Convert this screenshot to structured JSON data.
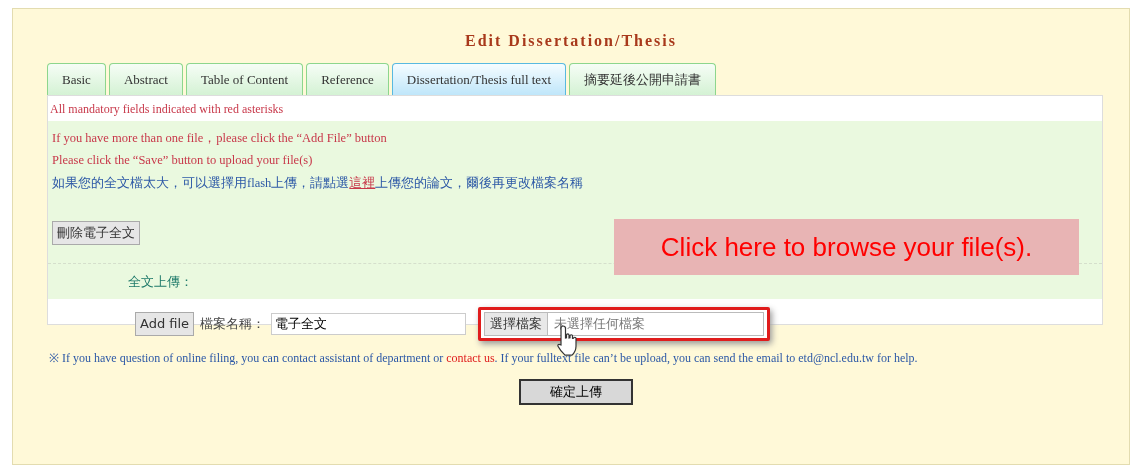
{
  "title": "Edit Dissertation/Thesis",
  "tabs": [
    {
      "label": "Basic",
      "selected": false
    },
    {
      "label": "Abstract",
      "selected": false
    },
    {
      "label": "Table of Content",
      "selected": false
    },
    {
      "label": "Reference",
      "selected": false
    },
    {
      "label": "Dissertation/Thesis full text",
      "selected": true
    },
    {
      "label": "摘要延後公開申請書",
      "selected": false
    }
  ],
  "mandatory_note": "All mandatory fields indicated with red asterisks",
  "instructions": [
    "If you have more than one file，please click the “Add File” button",
    "Please click the “Save” button to upload your file(s)"
  ],
  "flash_note": {
    "before": "如果您的全文檔太大，可以選擇用flash上傳，請點選",
    "link": "這裡",
    "after": "上傳您的論文，爾後再更改檔案名稱"
  },
  "delete_button": "刪除電子全文",
  "upload_label": "全文上傳：",
  "add_file_button": "Add file",
  "filename_label": "檔案名稱：",
  "filename_value": "電子全文",
  "choose_file_button": "選擇檔案",
  "no_file_text": "未選擇任何檔案",
  "callout": "Click here to browse your file(s).",
  "footnote": {
    "before": "※ If you have question of online filing, you can contact assistant of department or ",
    "link": "contact us",
    "after": ". If your fulltext file can’t be upload, you can send the email to etd@ncl.edu.tw for help."
  },
  "submit_button": "確定上傳"
}
